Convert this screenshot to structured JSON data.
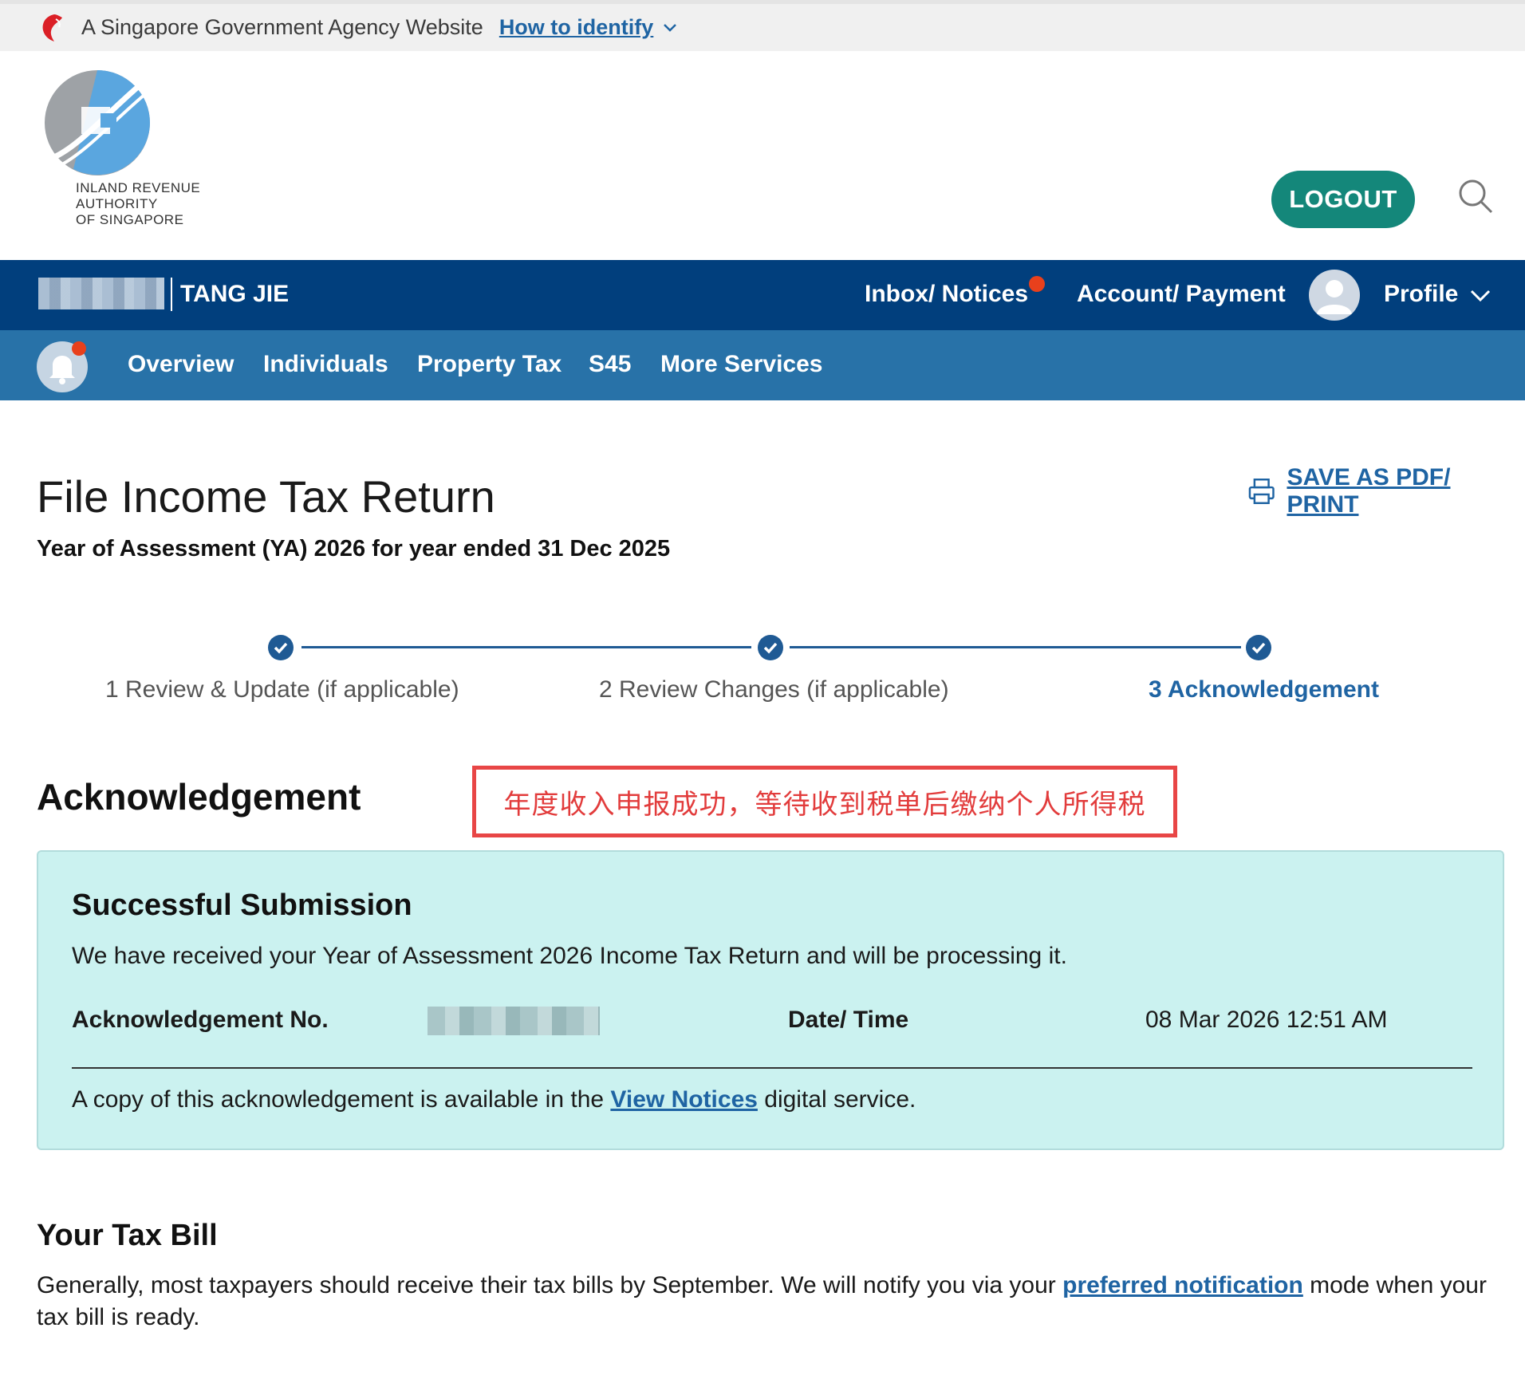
{
  "masthead": {
    "text": "A Singapore Government Agency Website",
    "identify_link": "How to identify"
  },
  "header": {
    "logo_line1": "INLAND REVENUE",
    "logo_line2": "AUTHORITY",
    "logo_line3": "OF SINGAPORE",
    "logout_label": "LOGOUT"
  },
  "nav_primary": {
    "user_name": "TANG JIE",
    "inbox_label": "Inbox/ Notices",
    "account_label": "Account/ Payment",
    "profile_label": "Profile"
  },
  "nav_secondary": {
    "items": [
      "Overview",
      "Individuals",
      "Property Tax",
      "S45",
      "More Services"
    ]
  },
  "page": {
    "title": "File Income Tax Return",
    "subtitle": "Year of Assessment (YA) 2026 for year ended 31 Dec 2025",
    "print_label": "SAVE AS PDF/ PRINT"
  },
  "stepper": {
    "steps": [
      {
        "label": "1 Review & Update (if applicable)"
      },
      {
        "label": "2 Review Changes (if applicable)"
      },
      {
        "label": "3 Acknowledgement"
      }
    ]
  },
  "acknowledgement": {
    "heading": "Acknowledgement",
    "annotation": "年度收入申报成功，等待收到税单后缴纳个人所得税",
    "box_title": "Successful Submission",
    "box_message": "We have received your Year of Assessment 2026 Income Tax Return and will be processing it.",
    "ack_no_label": "Acknowledgement No.",
    "datetime_label": "Date/ Time",
    "datetime_value": "08 Mar 2026 12:51 AM",
    "copy_prefix": "A copy of this acknowledgement is available in the ",
    "copy_link": "View Notices",
    "copy_suffix": " digital service."
  },
  "tax_bill": {
    "heading": "Your Tax Bill",
    "text_prefix": "Generally, most taxpayers should receive their tax bills by September. We will notify you via your ",
    "link": "preferred notification",
    "text_suffix": " mode when your tax bill is ready."
  },
  "colors": {
    "nav_primary": "#013f7d",
    "nav_secondary": "#2872a8",
    "logout": "#14877a",
    "success_bg": "#cbf2f0",
    "annotation": "#e84646"
  }
}
